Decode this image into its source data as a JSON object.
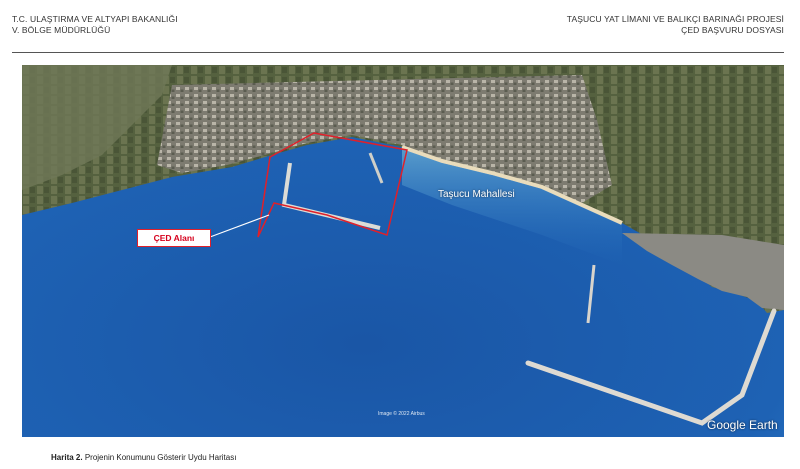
{
  "header": {
    "left_line1": "T.C. ULAŞTIRMA VE ALTYAPI BAKANLIĞI",
    "left_line2": "V. BÖLGE MÜDÜRLÜĞÜ",
    "right_line1": "TAŞUCU YAT LİMANI VE BALIKÇI BARINAĞI PROJESİ",
    "right_line2": "ÇED BAŞVURU DOSYASI"
  },
  "map": {
    "place_label": "Taşucu Mahallesi",
    "area_label": "ÇED Alanı",
    "imagery_credit": "Image © 2022 Airbus",
    "provider_logo": "Google Earth",
    "colors": {
      "sea": "#1d5fb0",
      "land": "#5e6a4c",
      "urban": "#8c8a80",
      "area_outline": "#e0202a"
    }
  },
  "caption": {
    "number": "Harita 2.",
    "text": "Projenin Konumunu Gösterir Uydu Haritası"
  }
}
